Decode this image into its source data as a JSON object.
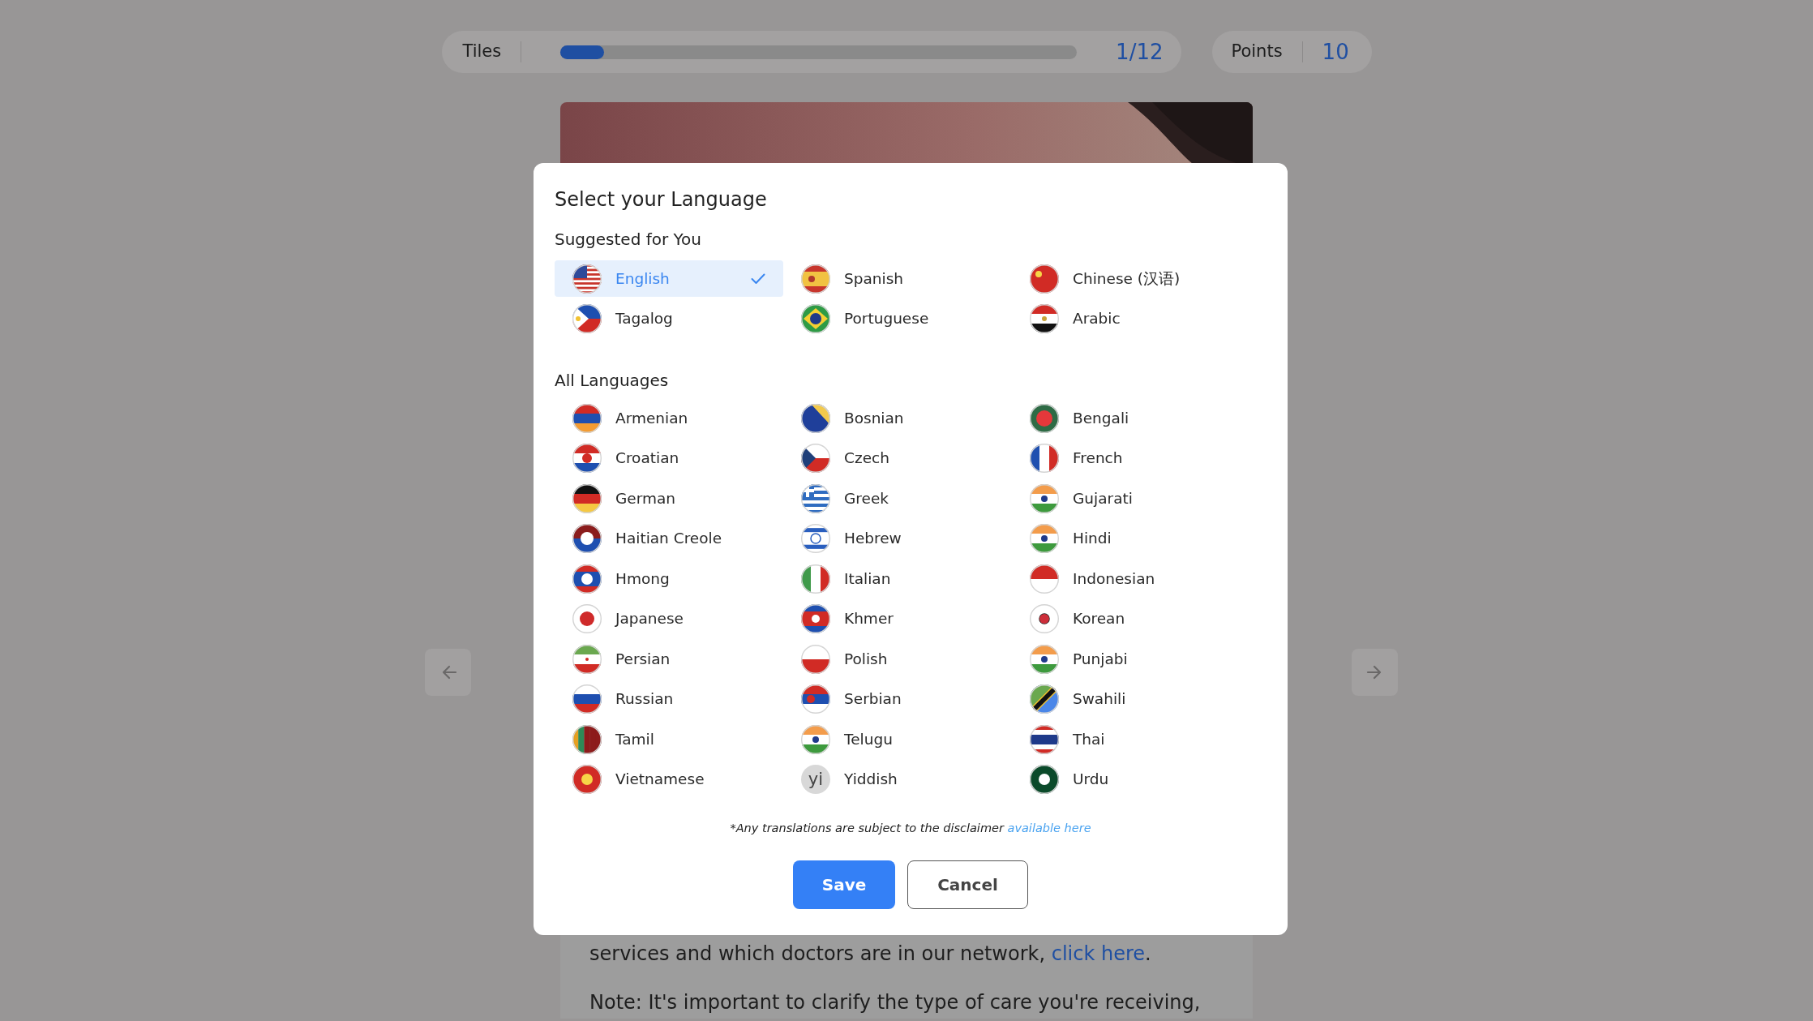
{
  "progress": {
    "label": "Tiles",
    "level": 0.085,
    "count": "1/12"
  },
  "points": {
    "label": "Points",
    "value": "10"
  },
  "content": {
    "paragraphs": [
      {
        "text": "services and which doctors are in our network, ",
        "link": "click here",
        "after": "."
      },
      {
        "text": "Note: It's important to clarify the type of care you're receiving,"
      }
    ]
  },
  "dialog": {
    "title": "Select your Language",
    "suggested_heading": "Suggested for You",
    "suggested": [
      {
        "name": "English",
        "selected": true
      },
      {
        "name": "Spanish",
        "selected": false
      },
      {
        "name": "Chinese (汉语)",
        "selected": false
      },
      {
        "name": "Tagalog",
        "selected": false
      },
      {
        "name": "Portuguese",
        "selected": false
      },
      {
        "name": "Arabic",
        "selected": false
      }
    ],
    "all_heading": "All Languages",
    "all": [
      {
        "name": "Armenian",
        "selected": false
      },
      {
        "name": "Bosnian",
        "selected": false
      },
      {
        "name": "Bengali",
        "selected": false
      },
      {
        "name": "Croatian",
        "selected": false
      },
      {
        "name": "Czech",
        "selected": false
      },
      {
        "name": "French",
        "selected": false
      },
      {
        "name": "German",
        "selected": false
      },
      {
        "name": "Greek",
        "selected": false
      },
      {
        "name": "Gujarati",
        "selected": false
      },
      {
        "name": "Haitian Creole",
        "selected": false
      },
      {
        "name": "Hebrew",
        "selected": false
      },
      {
        "name": "Hindi",
        "selected": false
      },
      {
        "name": "Hmong",
        "selected": false
      },
      {
        "name": "Italian",
        "selected": false
      },
      {
        "name": "Indonesian",
        "selected": false
      },
      {
        "name": "Japanese",
        "selected": false
      },
      {
        "name": "Khmer",
        "selected": false
      },
      {
        "name": "Korean",
        "selected": false
      },
      {
        "name": "Persian",
        "selected": false
      },
      {
        "name": "Polish",
        "selected": false
      },
      {
        "name": "Punjabi",
        "selected": false
      },
      {
        "name": "Russian",
        "selected": false
      },
      {
        "name": "Serbian",
        "selected": false
      },
      {
        "name": "Swahili",
        "selected": false
      },
      {
        "name": "Tamil",
        "selected": false
      },
      {
        "name": "Telugu",
        "selected": false
      },
      {
        "name": "Thai",
        "selected": false
      },
      {
        "name": "Vietnamese",
        "selected": false
      },
      {
        "name": "Yiddish",
        "selected": false,
        "icon_text": "yi"
      },
      {
        "name": "Urdu",
        "selected": false
      }
    ],
    "disclaimer": {
      "text": "*Any translations are subject to the disclaimer ",
      "link": "available here"
    },
    "buttons": [
      {
        "label": "Save",
        "kind": "primary"
      },
      {
        "label": "Cancel",
        "kind": "secondary"
      }
    ]
  }
}
